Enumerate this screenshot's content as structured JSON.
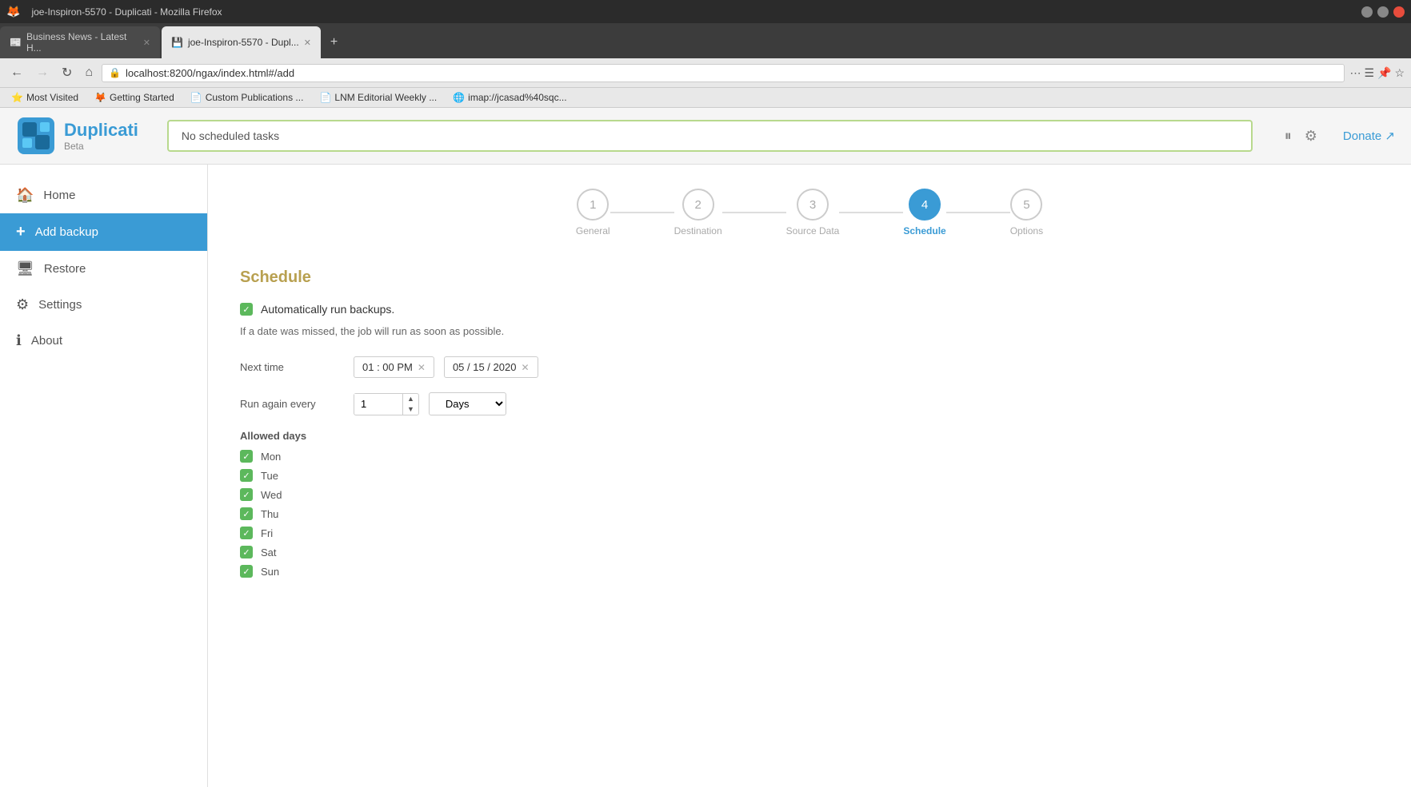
{
  "browser": {
    "title": "joe-Inspiron-5570 - Duplicati - Mozilla Firefox",
    "tabs": [
      {
        "label": "Business News - Latest H...",
        "active": false,
        "favicon": "📰"
      },
      {
        "label": "joe-Inspiron-5570 - Dupl...",
        "active": true,
        "favicon": "💾"
      }
    ],
    "address": "localhost:8200/ngax/index.html#/add",
    "bookmarks": [
      {
        "label": "Most Visited",
        "icon": "⭐"
      },
      {
        "label": "Getting Started",
        "icon": "🦊"
      },
      {
        "label": "Custom Publications ...",
        "icon": "📄"
      },
      {
        "label": "LNM Editorial Weekly ...",
        "icon": "📄"
      },
      {
        "label": "imap://jcasad%40sqc...",
        "icon": "🌐"
      }
    ]
  },
  "app": {
    "name": "Duplicati",
    "subtitle": "Beta",
    "status": "No scheduled tasks",
    "donate_label": "Donate ↗"
  },
  "sidebar": {
    "items": [
      {
        "label": "Home",
        "icon": "🏠",
        "id": "home"
      },
      {
        "label": "Add backup",
        "icon": "+",
        "id": "add-backup",
        "active": true
      },
      {
        "label": "Restore",
        "icon": "🖥",
        "id": "restore"
      },
      {
        "label": "Settings",
        "icon": "⚙",
        "id": "settings"
      },
      {
        "label": "About",
        "icon": "ℹ",
        "id": "about"
      }
    ]
  },
  "wizard": {
    "steps": [
      {
        "number": "1",
        "label": "General"
      },
      {
        "number": "2",
        "label": "Destination"
      },
      {
        "number": "3",
        "label": "Source Data"
      },
      {
        "number": "4",
        "label": "Schedule",
        "active": true
      },
      {
        "number": "5",
        "label": "Options"
      }
    ]
  },
  "schedule": {
    "title": "Schedule",
    "auto_run_label": "Automatically run backups.",
    "missed_date_info": "If a date was missed, the job will run as soon as possible.",
    "next_time_label": "Next time",
    "time_value": "01 : 00  PM",
    "date_value": "05 / 15 / 2020",
    "run_again_label": "Run again every",
    "interval_value": "1",
    "interval_unit": "Days",
    "allowed_days_label": "Allowed days",
    "days": [
      {
        "label": "Mon",
        "checked": true
      },
      {
        "label": "Tue",
        "checked": true
      },
      {
        "label": "Wed",
        "checked": true
      },
      {
        "label": "Thu",
        "checked": true
      },
      {
        "label": "Fri",
        "checked": true
      },
      {
        "label": "Sat",
        "checked": true
      },
      {
        "label": "Sun",
        "checked": true
      }
    ]
  }
}
